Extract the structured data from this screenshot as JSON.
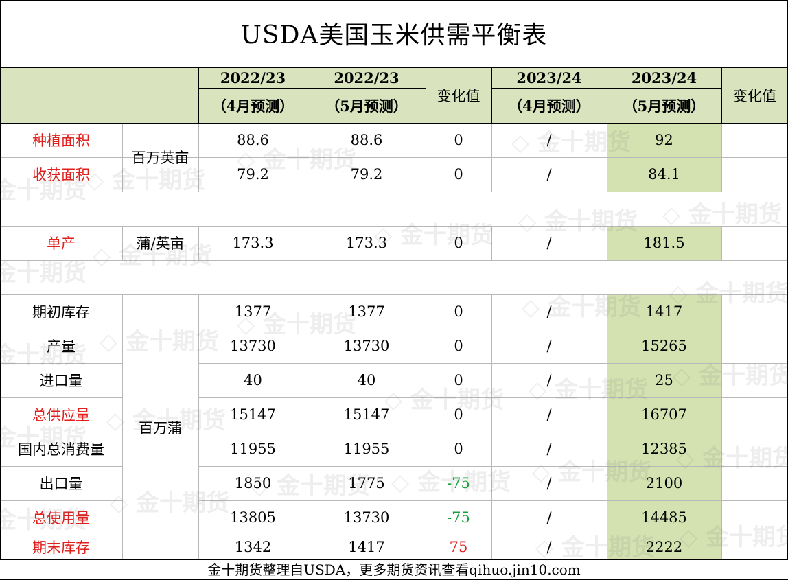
{
  "title": "USDA美国玉米供需平衡表",
  "header": {
    "col1_year": "2022/23",
    "col1_sub": "（4月预测）",
    "col2_year": "2022/23",
    "col2_sub": "（5月预测）",
    "change1": "变化值",
    "col3_year": "2023/24",
    "col3_sub": "（4月预测）",
    "col4_year": "2023/24",
    "col4_sub": "（5月预测）",
    "change2": "变化值"
  },
  "units": {
    "area": "百万英亩",
    "yield": "蒲/英亩",
    "bushel": "百万蒲"
  },
  "rows": [
    {
      "label": "种植面积",
      "c1": "88.6",
      "c2": "88.6",
      "chg": "0",
      "c3": "/",
      "c4": "92"
    },
    {
      "label": "收获面积",
      "c1": "79.2",
      "c2": "79.2",
      "chg": "0",
      "c3": "/",
      "c4": "84.1"
    },
    {
      "label": "单产",
      "c1": "173.3",
      "c2": "173.3",
      "chg": "0",
      "c3": "/",
      "c4": "181.5"
    },
    {
      "label": "期初库存",
      "c1": "1377",
      "c2": "1377",
      "chg": "0",
      "c3": "/",
      "c4": "1417"
    },
    {
      "label": "产量",
      "c1": "13730",
      "c2": "13730",
      "chg": "0",
      "c3": "/",
      "c4": "15265"
    },
    {
      "label": "进口量",
      "c1": "40",
      "c2": "40",
      "chg": "0",
      "c3": "/",
      "c4": "25"
    },
    {
      "label": "总供应量",
      "c1": "15147",
      "c2": "15147",
      "chg": "0",
      "c3": "/",
      "c4": "16707"
    },
    {
      "label": "国内总消费量",
      "c1": "11955",
      "c2": "11955",
      "chg": "0",
      "c3": "/",
      "c4": "12385"
    },
    {
      "label": "出口量",
      "c1": "1850",
      "c2": "1775",
      "chg": "-75",
      "c3": "/",
      "c4": "2100"
    },
    {
      "label": "总使用量",
      "c1": "13805",
      "c2": "13730",
      "chg": "-75",
      "c3": "/",
      "c4": "14485"
    },
    {
      "label": "期末库存",
      "c1": "1342",
      "c2": "1417",
      "chg": "75",
      "c3": "/",
      "c4": "2222"
    }
  ],
  "watermark": "金十期货",
  "footer": "金十期货整理自USDA，更多期货资讯查看qihuo.jin10.com",
  "colors": {
    "header_bg": "#d9e4bf",
    "highlight_bg": "#d3e2b0",
    "red_text": "#e0201d",
    "green_text": "#1aa03a"
  }
}
